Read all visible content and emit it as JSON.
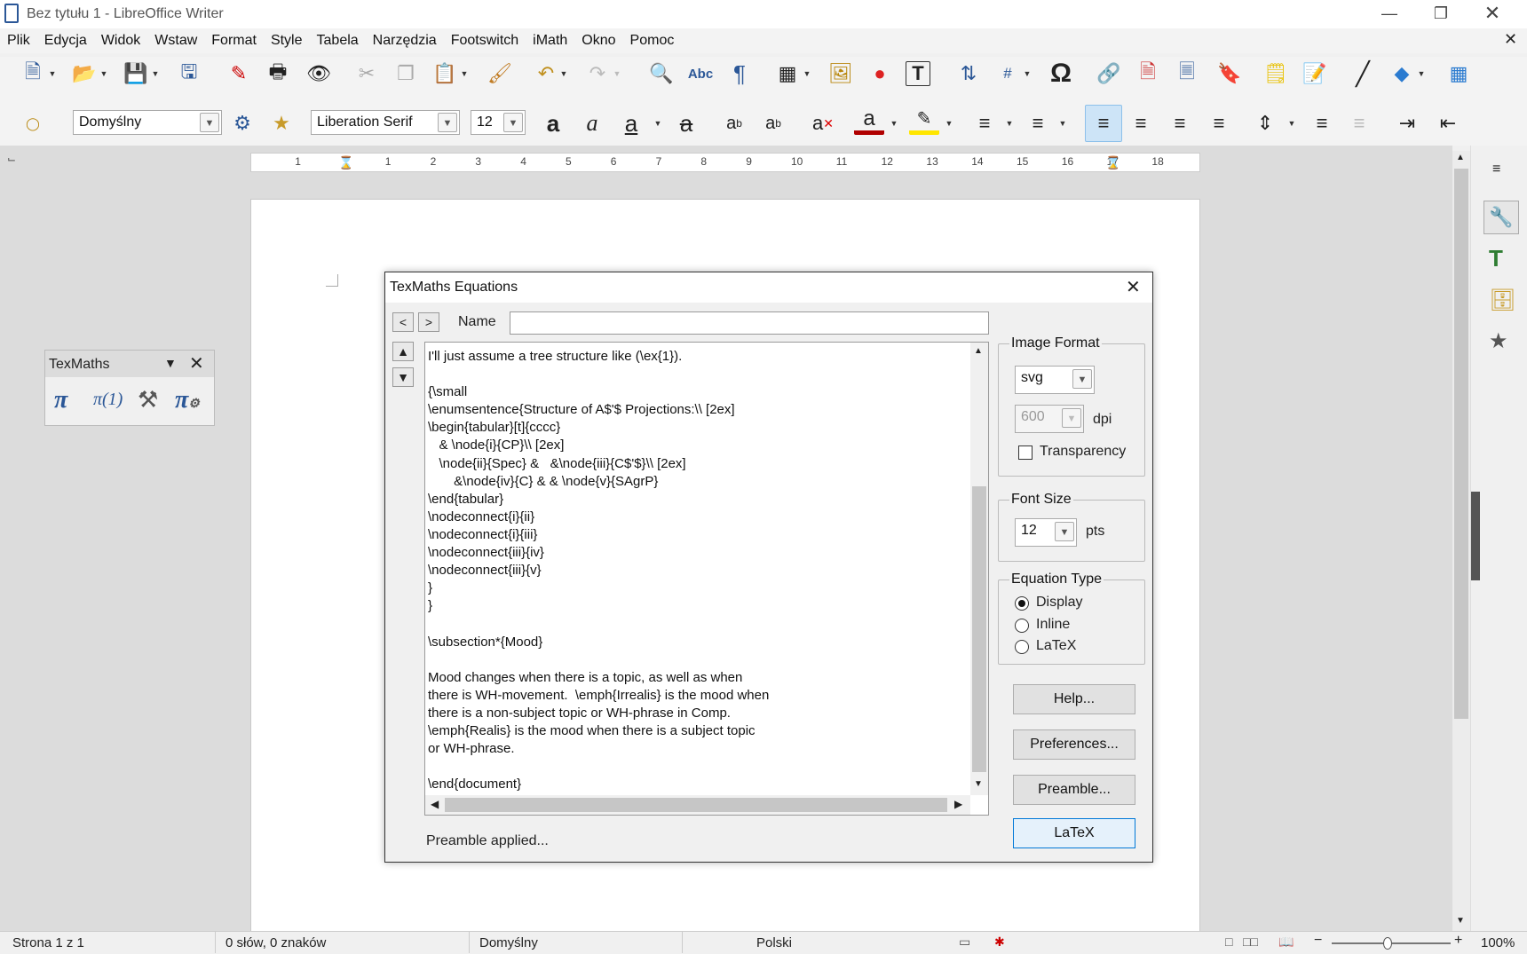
{
  "window": {
    "title": "Bez tytułu 1 - LibreOffice Writer"
  },
  "menu": [
    "Plik",
    "Edycja",
    "Widok",
    "Wstaw",
    "Format",
    "Style",
    "Tabela",
    "Narzędzia",
    "Footswitch",
    "iMath",
    "Okno",
    "Pomoc"
  ],
  "formatting": {
    "paragraph_style": "Domyślny",
    "font_name": "Liberation Serif",
    "font_size": "12"
  },
  "ruler": {
    "ticks": [
      "1",
      "1",
      "2",
      "3",
      "4",
      "5",
      "6",
      "7",
      "8",
      "9",
      "10",
      "11",
      "12",
      "13",
      "14",
      "15",
      "16",
      "17",
      "18"
    ]
  },
  "texmaths_toolbar": {
    "title": "TexMaths"
  },
  "dialog": {
    "title": "TexMaths Equations",
    "name_label": "Name",
    "name_value": "",
    "code_text": "I'll just assume a tree structure like (\\ex{1}).\n\n{\\small\n\\enumsentence{Structure of A$'$ Projections:\\\\ [2ex]\n\\begin{tabular}[t]{cccc}\n   & \\node{i}{CP}\\\\ [2ex]\n   \\node{ii}{Spec} &   &\\node{iii}{C$'$}\\\\ [2ex]\n       &\\node{iv}{C} & & \\node{v}{SAgrP}\n\\end{tabular}\n\\nodeconnect{i}{ii}\n\\nodeconnect{i}{iii}\n\\nodeconnect{iii}{iv}\n\\nodeconnect{iii}{v}\n}\n}\n\n\\subsection*{Mood}\n\nMood changes when there is a topic, as well as when\nthere is WH-movement.  \\emph{Irrealis} is the mood when\nthere is a non-subject topic or WH-phrase in Comp.\n\\emph{Realis} is the mood when there is a subject topic\nor WH-phrase.\n\n\\end{document}",
    "image_format": {
      "label": "Image Format",
      "value": "svg",
      "dpi_value": "600",
      "dpi_label": "dpi",
      "transparency_label": "Transparency",
      "transparency_checked": false
    },
    "font_size": {
      "label": "Font Size",
      "value": "12",
      "unit": "pts"
    },
    "equation_type": {
      "label": "Equation Type",
      "options": [
        "Display",
        "Inline",
        "LaTeX"
      ],
      "selected": "Display"
    },
    "buttons": {
      "help": "Help...",
      "preferences": "Preferences...",
      "preamble": "Preamble...",
      "latex": "LaTeX"
    },
    "status": "Preamble applied..."
  },
  "statusbar": {
    "page": "Strona 1 z 1",
    "words": "0 słów, 0 znaków",
    "style": "Domyślny",
    "language": "Polski",
    "zoom": "100%"
  },
  "colors": {
    "accent": "#2b5797",
    "selected_button_bg": "#e5f1fb",
    "selected_button_border": "#0078d7"
  }
}
